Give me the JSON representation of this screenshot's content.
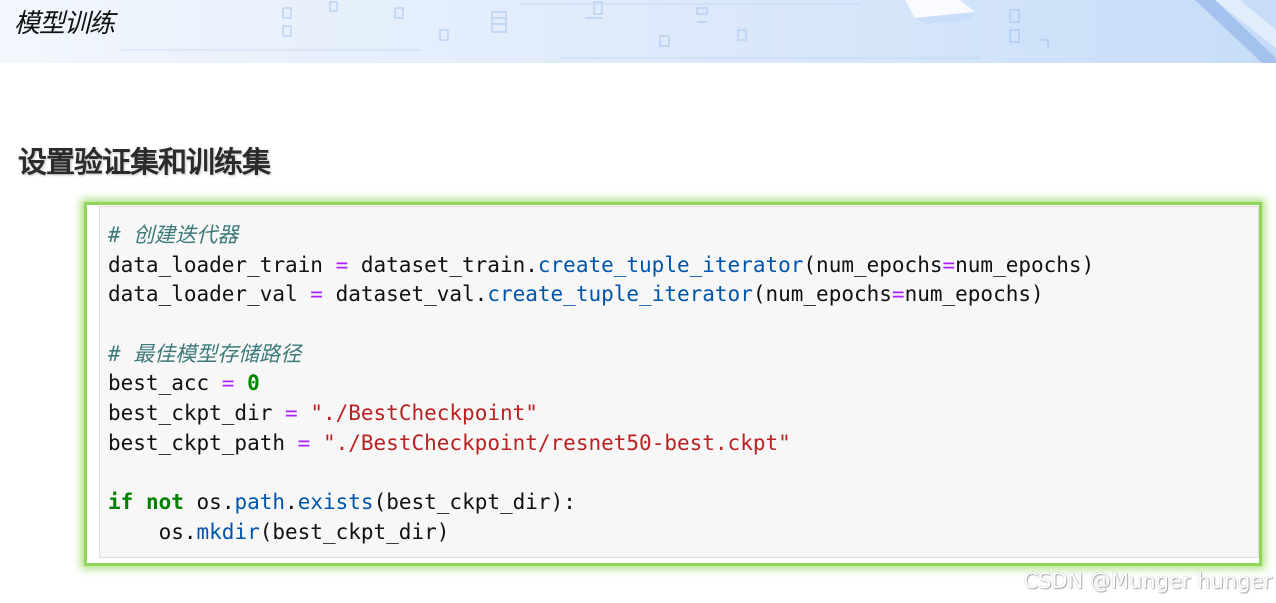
{
  "banner": {
    "title": "模型训练"
  },
  "section": {
    "title": "设置验证集和训练集"
  },
  "code": {
    "lines": [
      [
        {
          "t": "# 创建迭代器",
          "c": "comment"
        }
      ],
      [
        {
          "t": "data_loader_train ",
          "c": "plain"
        },
        {
          "t": "=",
          "c": "op"
        },
        {
          "t": " dataset_train.",
          "c": "plain"
        },
        {
          "t": "create_tuple_iterator",
          "c": "func"
        },
        {
          "t": "(num_epochs",
          "c": "plain"
        },
        {
          "t": "=",
          "c": "op"
        },
        {
          "t": "num_epochs)",
          "c": "plain"
        }
      ],
      [
        {
          "t": "data_loader_val ",
          "c": "plain"
        },
        {
          "t": "=",
          "c": "op"
        },
        {
          "t": " dataset_val.",
          "c": "plain"
        },
        {
          "t": "create_tuple_iterator",
          "c": "func"
        },
        {
          "t": "(num_epochs",
          "c": "plain"
        },
        {
          "t": "=",
          "c": "op"
        },
        {
          "t": "num_epochs)",
          "c": "plain"
        }
      ],
      [],
      [
        {
          "t": "# 最佳模型存储路径",
          "c": "comment"
        }
      ],
      [
        {
          "t": "best_acc ",
          "c": "plain"
        },
        {
          "t": "=",
          "c": "op"
        },
        {
          "t": " ",
          "c": "plain"
        },
        {
          "t": "0",
          "c": "num"
        }
      ],
      [
        {
          "t": "best_ckpt_dir ",
          "c": "plain"
        },
        {
          "t": "=",
          "c": "op"
        },
        {
          "t": " ",
          "c": "plain"
        },
        {
          "t": "\"./BestCheckpoint\"",
          "c": "str"
        }
      ],
      [
        {
          "t": "best_ckpt_path ",
          "c": "plain"
        },
        {
          "t": "=",
          "c": "op"
        },
        {
          "t": " ",
          "c": "plain"
        },
        {
          "t": "\"./BestCheckpoint/resnet50-best.ckpt\"",
          "c": "str"
        }
      ],
      [],
      [
        {
          "t": "if",
          "c": "kw"
        },
        {
          "t": " ",
          "c": "plain"
        },
        {
          "t": "not",
          "c": "kwop"
        },
        {
          "t": " os.",
          "c": "plain"
        },
        {
          "t": "path",
          "c": "attr"
        },
        {
          "t": ".",
          "c": "plain"
        },
        {
          "t": "exists",
          "c": "func"
        },
        {
          "t": "(best_ckpt_dir):",
          "c": "plain"
        }
      ],
      [
        {
          "t": "    os.",
          "c": "plain"
        },
        {
          "t": "mkdir",
          "c": "func"
        },
        {
          "t": "(best_ckpt_dir)",
          "c": "plain"
        }
      ]
    ]
  },
  "watermark": {
    "text": "CSDN @Munger hunger"
  },
  "colors": {
    "highlight_border": "#8fd65a",
    "code_background": "#f7f7f7",
    "comment": "#3d7b7b",
    "operator": "#aa22ff",
    "function": "#0055aa",
    "string": "#ba2121",
    "keyword": "#008000"
  }
}
